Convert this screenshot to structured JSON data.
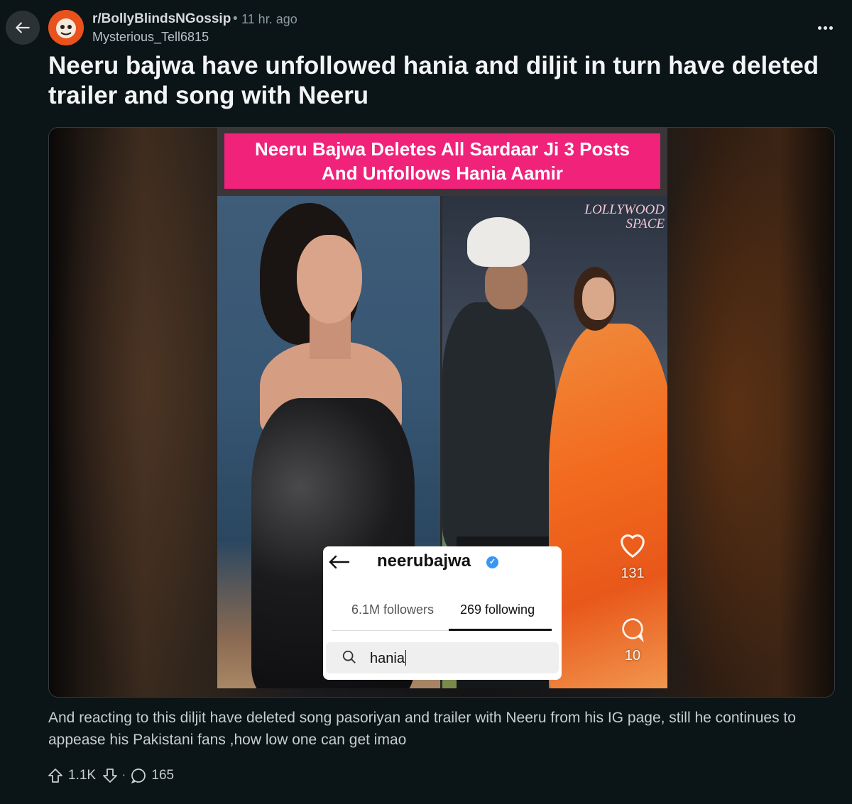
{
  "post": {
    "subreddit": "r/BollyBlindsNGossip",
    "separator": "•",
    "time": "11 hr. ago",
    "author": "Mysterious_Tell6815",
    "title": "Neeru bajwa have unfollowed hania and diljit in turn have deleted trailer and song with Neeru",
    "body": "And reacting to this diljit have deleted song pasoriyan and trailer with Neeru from his IG page, still he continues to appease his Pakistani fans ,how low one can get imao"
  },
  "media": {
    "banner_line1": "Neeru Bajwa Deletes All Sardaar Ji 3 Posts",
    "banner_line2": "And Unfollows Hania Aamir",
    "watermark_line1": "LOLLYWOOD",
    "watermark_line2": "SPACE",
    "like_count": "131",
    "comment_count": "10",
    "ig_card": {
      "username": "neerubajwa",
      "followers": "6.1M followers",
      "following": "269 following",
      "search_value": "hania"
    }
  },
  "actions": {
    "score": "1.1K",
    "separator": "·",
    "comments": "165"
  },
  "icons": {
    "back": "arrow-left-icon",
    "more": "ellipsis-icon",
    "upvote": "upvote-arrow-icon",
    "downvote": "downvote-arrow-icon",
    "comments": "speech-bubble-icon"
  },
  "colors": {
    "background": "#0b1416",
    "banner": "#f0227a",
    "avatar": "#e9521d",
    "verified": "#3897f0"
  }
}
